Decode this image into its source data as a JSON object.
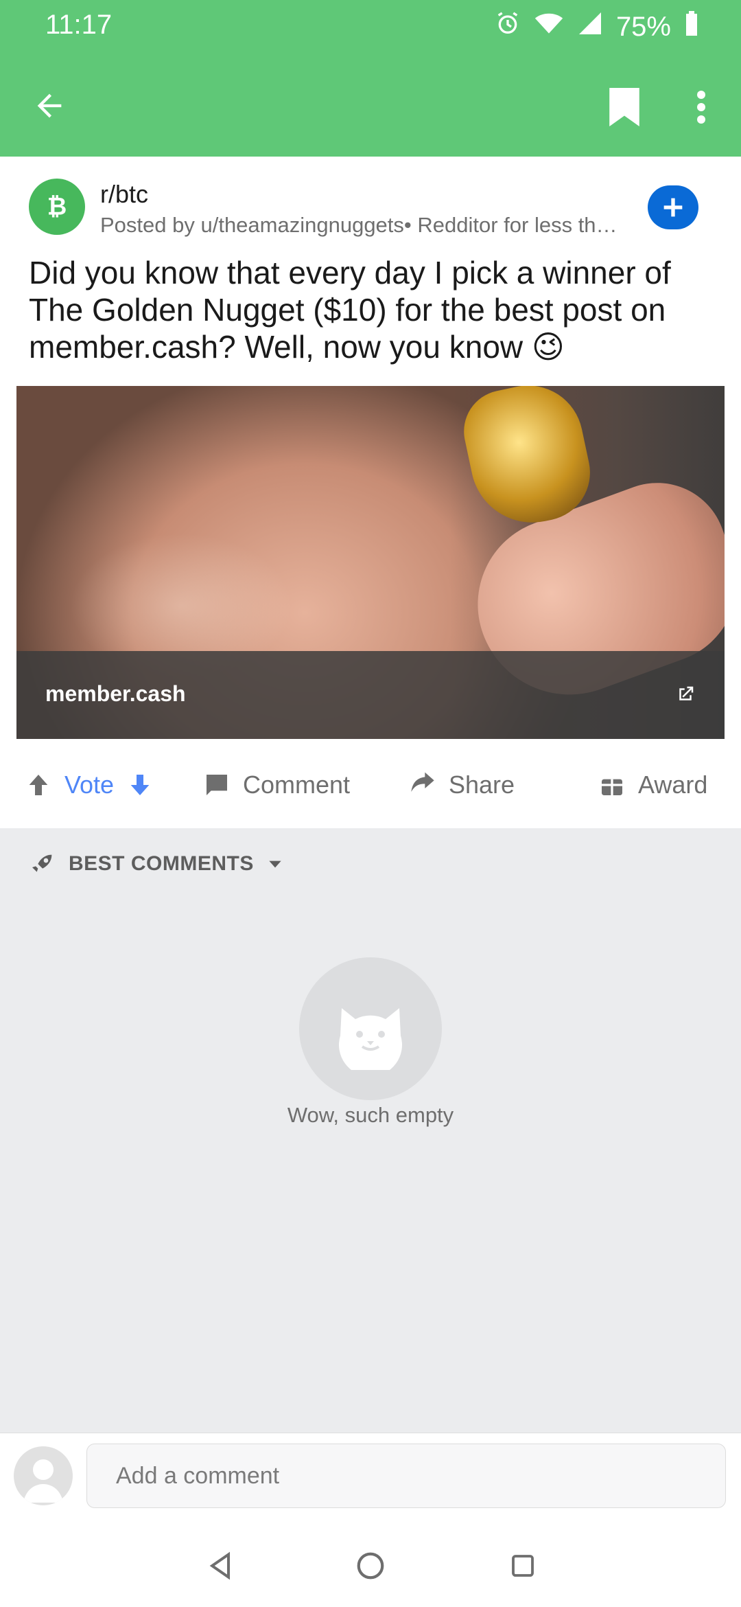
{
  "status": {
    "time": "11:17",
    "battery": "75%",
    "icons": [
      "alarm-icon",
      "wifi-icon",
      "signal-icon",
      "battery-icon"
    ]
  },
  "appbar": {
    "back": "back-arrow-icon",
    "bookmark": "bookmark-icon",
    "more": "more-vertical-icon"
  },
  "post": {
    "subreddit": "r/btc",
    "posted_by": "Posted by u/theamazingnuggets• Redditor for less th…",
    "title": "Did you know that every day I pick a winner of The Golden Nugget ($10) for the best post on member.cash? Well, now you know 😉",
    "link_domain": "member.cash"
  },
  "actions": {
    "vote": "Vote",
    "comment": "Comment",
    "share": "Share",
    "award": "Award"
  },
  "comments": {
    "sort_label": "BEST COMMENTS",
    "empty_text": "Wow, such empty"
  },
  "composer": {
    "placeholder": "Add a comment"
  },
  "colors": {
    "accent": "#5fc877",
    "join": "#0a6ad6",
    "vote": "#4f86f7"
  }
}
